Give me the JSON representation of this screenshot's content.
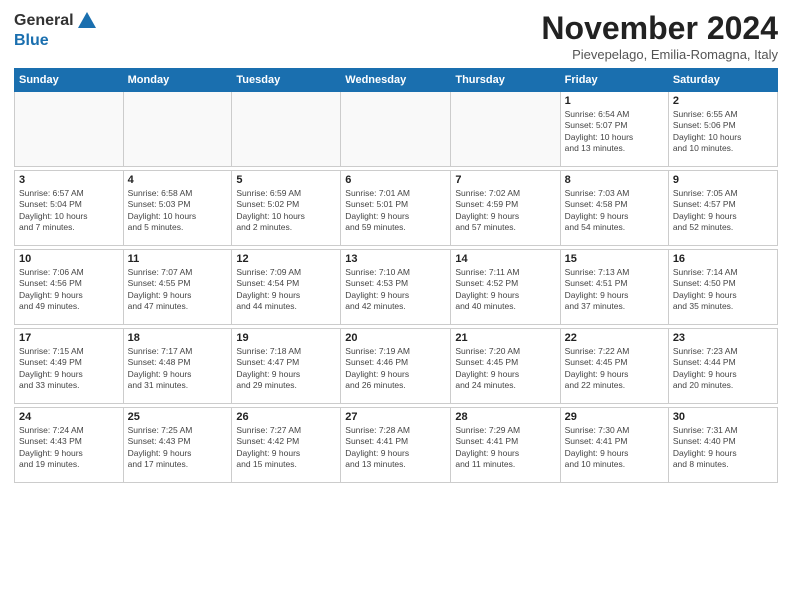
{
  "logo": {
    "general": "General",
    "blue": "Blue"
  },
  "title": "November 2024",
  "location": "Pievepelago, Emilia-Romagna, Italy",
  "days_of_week": [
    "Sunday",
    "Monday",
    "Tuesday",
    "Wednesday",
    "Thursday",
    "Friday",
    "Saturday"
  ],
  "weeks": [
    [
      {
        "day": "",
        "info": ""
      },
      {
        "day": "",
        "info": ""
      },
      {
        "day": "",
        "info": ""
      },
      {
        "day": "",
        "info": ""
      },
      {
        "day": "",
        "info": ""
      },
      {
        "day": "1",
        "info": "Sunrise: 6:54 AM\nSunset: 5:07 PM\nDaylight: 10 hours\nand 13 minutes."
      },
      {
        "day": "2",
        "info": "Sunrise: 6:55 AM\nSunset: 5:06 PM\nDaylight: 10 hours\nand 10 minutes."
      }
    ],
    [
      {
        "day": "3",
        "info": "Sunrise: 6:57 AM\nSunset: 5:04 PM\nDaylight: 10 hours\nand 7 minutes."
      },
      {
        "day": "4",
        "info": "Sunrise: 6:58 AM\nSunset: 5:03 PM\nDaylight: 10 hours\nand 5 minutes."
      },
      {
        "day": "5",
        "info": "Sunrise: 6:59 AM\nSunset: 5:02 PM\nDaylight: 10 hours\nand 2 minutes."
      },
      {
        "day": "6",
        "info": "Sunrise: 7:01 AM\nSunset: 5:01 PM\nDaylight: 9 hours\nand 59 minutes."
      },
      {
        "day": "7",
        "info": "Sunrise: 7:02 AM\nSunset: 4:59 PM\nDaylight: 9 hours\nand 57 minutes."
      },
      {
        "day": "8",
        "info": "Sunrise: 7:03 AM\nSunset: 4:58 PM\nDaylight: 9 hours\nand 54 minutes."
      },
      {
        "day": "9",
        "info": "Sunrise: 7:05 AM\nSunset: 4:57 PM\nDaylight: 9 hours\nand 52 minutes."
      }
    ],
    [
      {
        "day": "10",
        "info": "Sunrise: 7:06 AM\nSunset: 4:56 PM\nDaylight: 9 hours\nand 49 minutes."
      },
      {
        "day": "11",
        "info": "Sunrise: 7:07 AM\nSunset: 4:55 PM\nDaylight: 9 hours\nand 47 minutes."
      },
      {
        "day": "12",
        "info": "Sunrise: 7:09 AM\nSunset: 4:54 PM\nDaylight: 9 hours\nand 44 minutes."
      },
      {
        "day": "13",
        "info": "Sunrise: 7:10 AM\nSunset: 4:53 PM\nDaylight: 9 hours\nand 42 minutes."
      },
      {
        "day": "14",
        "info": "Sunrise: 7:11 AM\nSunset: 4:52 PM\nDaylight: 9 hours\nand 40 minutes."
      },
      {
        "day": "15",
        "info": "Sunrise: 7:13 AM\nSunset: 4:51 PM\nDaylight: 9 hours\nand 37 minutes."
      },
      {
        "day": "16",
        "info": "Sunrise: 7:14 AM\nSunset: 4:50 PM\nDaylight: 9 hours\nand 35 minutes."
      }
    ],
    [
      {
        "day": "17",
        "info": "Sunrise: 7:15 AM\nSunset: 4:49 PM\nDaylight: 9 hours\nand 33 minutes."
      },
      {
        "day": "18",
        "info": "Sunrise: 7:17 AM\nSunset: 4:48 PM\nDaylight: 9 hours\nand 31 minutes."
      },
      {
        "day": "19",
        "info": "Sunrise: 7:18 AM\nSunset: 4:47 PM\nDaylight: 9 hours\nand 29 minutes."
      },
      {
        "day": "20",
        "info": "Sunrise: 7:19 AM\nSunset: 4:46 PM\nDaylight: 9 hours\nand 26 minutes."
      },
      {
        "day": "21",
        "info": "Sunrise: 7:20 AM\nSunset: 4:45 PM\nDaylight: 9 hours\nand 24 minutes."
      },
      {
        "day": "22",
        "info": "Sunrise: 7:22 AM\nSunset: 4:45 PM\nDaylight: 9 hours\nand 22 minutes."
      },
      {
        "day": "23",
        "info": "Sunrise: 7:23 AM\nSunset: 4:44 PM\nDaylight: 9 hours\nand 20 minutes."
      }
    ],
    [
      {
        "day": "24",
        "info": "Sunrise: 7:24 AM\nSunset: 4:43 PM\nDaylight: 9 hours\nand 19 minutes."
      },
      {
        "day": "25",
        "info": "Sunrise: 7:25 AM\nSunset: 4:43 PM\nDaylight: 9 hours\nand 17 minutes."
      },
      {
        "day": "26",
        "info": "Sunrise: 7:27 AM\nSunset: 4:42 PM\nDaylight: 9 hours\nand 15 minutes."
      },
      {
        "day": "27",
        "info": "Sunrise: 7:28 AM\nSunset: 4:41 PM\nDaylight: 9 hours\nand 13 minutes."
      },
      {
        "day": "28",
        "info": "Sunrise: 7:29 AM\nSunset: 4:41 PM\nDaylight: 9 hours\nand 11 minutes."
      },
      {
        "day": "29",
        "info": "Sunrise: 7:30 AM\nSunset: 4:41 PM\nDaylight: 9 hours\nand 10 minutes."
      },
      {
        "day": "30",
        "info": "Sunrise: 7:31 AM\nSunset: 4:40 PM\nDaylight: 9 hours\nand 8 minutes."
      }
    ]
  ]
}
